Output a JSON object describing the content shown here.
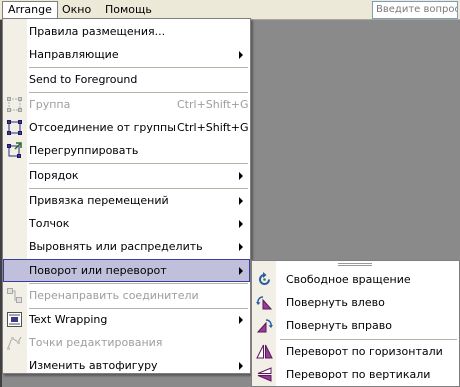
{
  "menubar": {
    "items": [
      {
        "label": "Arrange",
        "active": true
      },
      {
        "label": "Окно",
        "active": false
      },
      {
        "label": "Помощь",
        "active": false
      }
    ],
    "help_placeholder": "Введите вопрос"
  },
  "menu": {
    "items": [
      {
        "label": "Правила размещения..."
      },
      {
        "label": "Направляющие"
      },
      {
        "label": "Send to Foreground"
      },
      {
        "label": "Группа",
        "shortcut": "Ctrl+Shift+G"
      },
      {
        "label": "Отсоединение от группы",
        "shortcut": "Ctrl+Shift+G"
      },
      {
        "label": "Перегруппировать"
      },
      {
        "label": "Порядок"
      },
      {
        "label": "Привязка перемещений"
      },
      {
        "label": "Толчок"
      },
      {
        "label": "Выровнять или распределить"
      },
      {
        "label": "Поворот или переворот"
      },
      {
        "label": "Перенаправить соединители"
      },
      {
        "label": "Text Wrapping"
      },
      {
        "label": "Точки редактирования"
      },
      {
        "label": "Изменить автофигуру"
      }
    ]
  },
  "submenu": {
    "items": [
      {
        "label": "Свободное вращение",
        "icon": "free-rotate-icon"
      },
      {
        "label": "Повернуть влево",
        "icon": "rotate-left-icon"
      },
      {
        "label": "Повернуть вправо",
        "icon": "rotate-right-icon"
      },
      {
        "label": "Переворот по горизонтали",
        "icon": "flip-horizontal-icon"
      },
      {
        "label": "Переворот по вертикали",
        "icon": "flip-vertical-icon"
      }
    ]
  },
  "colors": {
    "highlight_bg": "#c1c0dc",
    "highlight_border": "#3c3c9c",
    "disabled_text": "#9d9d9d"
  }
}
